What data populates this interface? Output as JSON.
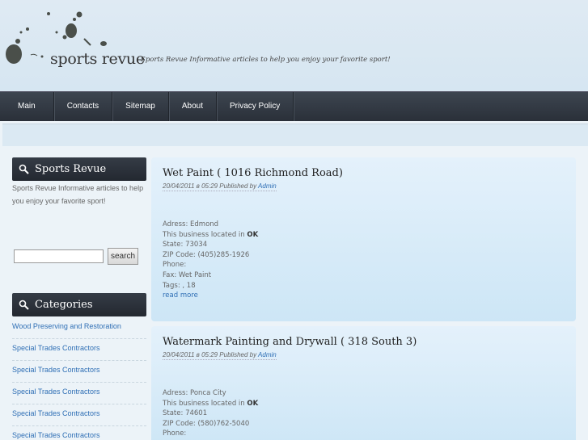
{
  "header": {
    "site_name": "sports revue",
    "tagline": "Sports Revue Informative articles to help you enjoy your favorite sport!"
  },
  "nav": {
    "items": [
      "Main",
      "Contacts",
      "Sitemap",
      "About",
      "Privacy Policy"
    ]
  },
  "sidebar": {
    "about": {
      "title": "Sports Revue",
      "description": "Sports Revue Informative articles to help you enjoy your favorite sport!"
    },
    "search": {
      "value": "",
      "button_label": "search"
    },
    "categories": {
      "title": "Categories",
      "items": [
        "Wood Preserving and Restoration",
        "Special Trades Contractors",
        "Special Trades Contractors",
        "Special Trades Contractors",
        "Special Trades Contractors",
        "Special Trades Contractors"
      ]
    }
  },
  "posts": [
    {
      "title": "Wet Paint ( 1016 Richmond Road)",
      "meta_prefix": "20/04/2011 в 05:29 Published by ",
      "author": "Admin",
      "address": "Adress: Edmond",
      "located_prefix": "This business located in ",
      "located_state": "OK",
      "state": "State: 73034",
      "zip": "ZIP Code: (405)285-1926",
      "phone": "Phone:",
      "fax": "Fax: Wet Paint",
      "tags": "Tags: , 18",
      "read_more": "read more"
    },
    {
      "title": "Watermark Painting and Drywall ( 318 South 3)",
      "meta_prefix": "20/04/2011 в 05:29 Published by ",
      "author": "Admin",
      "address": "Adress: Ponca City",
      "located_prefix": "This business located in ",
      "located_state": "OK",
      "state": "State: 74601",
      "zip": "ZIP Code: (580)762-5040",
      "phone": "Phone:"
    }
  ],
  "colors": {
    "nav_bg": "#2f353e",
    "link": "#2f6fb5",
    "post_bg": "#d6ebf8"
  }
}
